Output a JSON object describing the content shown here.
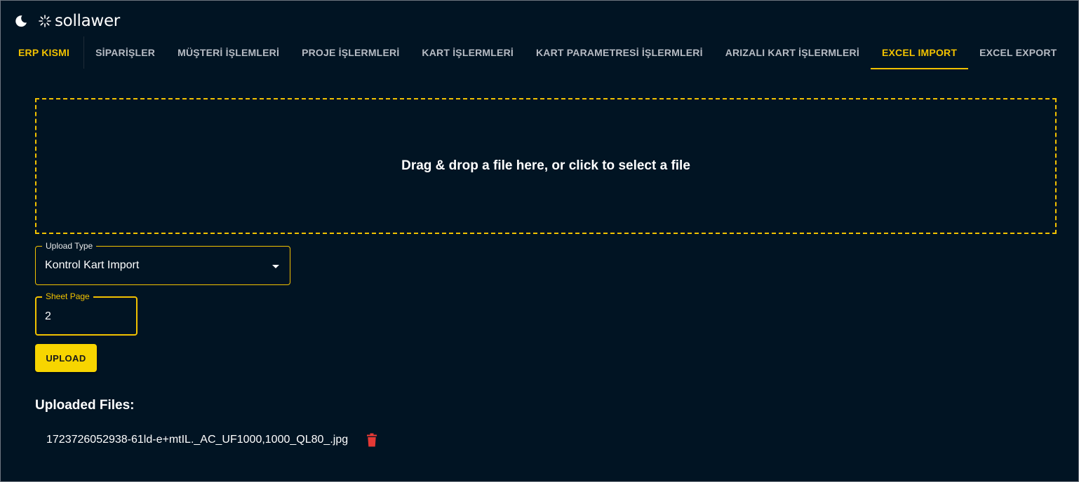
{
  "header": {
    "theme_icon": "moon-icon",
    "logo_icon": "sun-rays-icon",
    "logo_text": "sollawer"
  },
  "nav": {
    "items": [
      {
        "label": "ERP KISMI"
      },
      {
        "label": "SİPARİŞLER"
      },
      {
        "label": "MÜŞTERİ İŞLEMLERİ"
      },
      {
        "label": "PROJE İŞLERMLERİ"
      },
      {
        "label": "KART İŞLERMLERİ"
      },
      {
        "label": "KART PARAMETRESİ İŞLERMLERİ"
      },
      {
        "label": "ARIZALI KART İŞLERMLERİ"
      },
      {
        "label": "EXCEL IMPORT"
      },
      {
        "label": "EXCEL EXPORT"
      }
    ],
    "active": "EXCEL IMPORT"
  },
  "dropzone": {
    "text": "Drag & drop a file here, or click to select a file"
  },
  "form": {
    "upload_type": {
      "label": "Upload Type",
      "value": "Kontrol Kart Import"
    },
    "sheet_page": {
      "label": "Sheet Page",
      "value": "2"
    },
    "upload_button": "UPLOAD"
  },
  "uploaded": {
    "title": "Uploaded Files:",
    "files": [
      {
        "name": "1723726052938-61ld-e+mtIL._AC_UF1000,1000_QL80_.jpg",
        "action_icon": "trash-icon"
      }
    ]
  },
  "colors": {
    "background": "#011423",
    "accent": "#f2c200",
    "button": "#f7d500",
    "delete": "#e53935",
    "nav_text": "#b7bcc4"
  }
}
